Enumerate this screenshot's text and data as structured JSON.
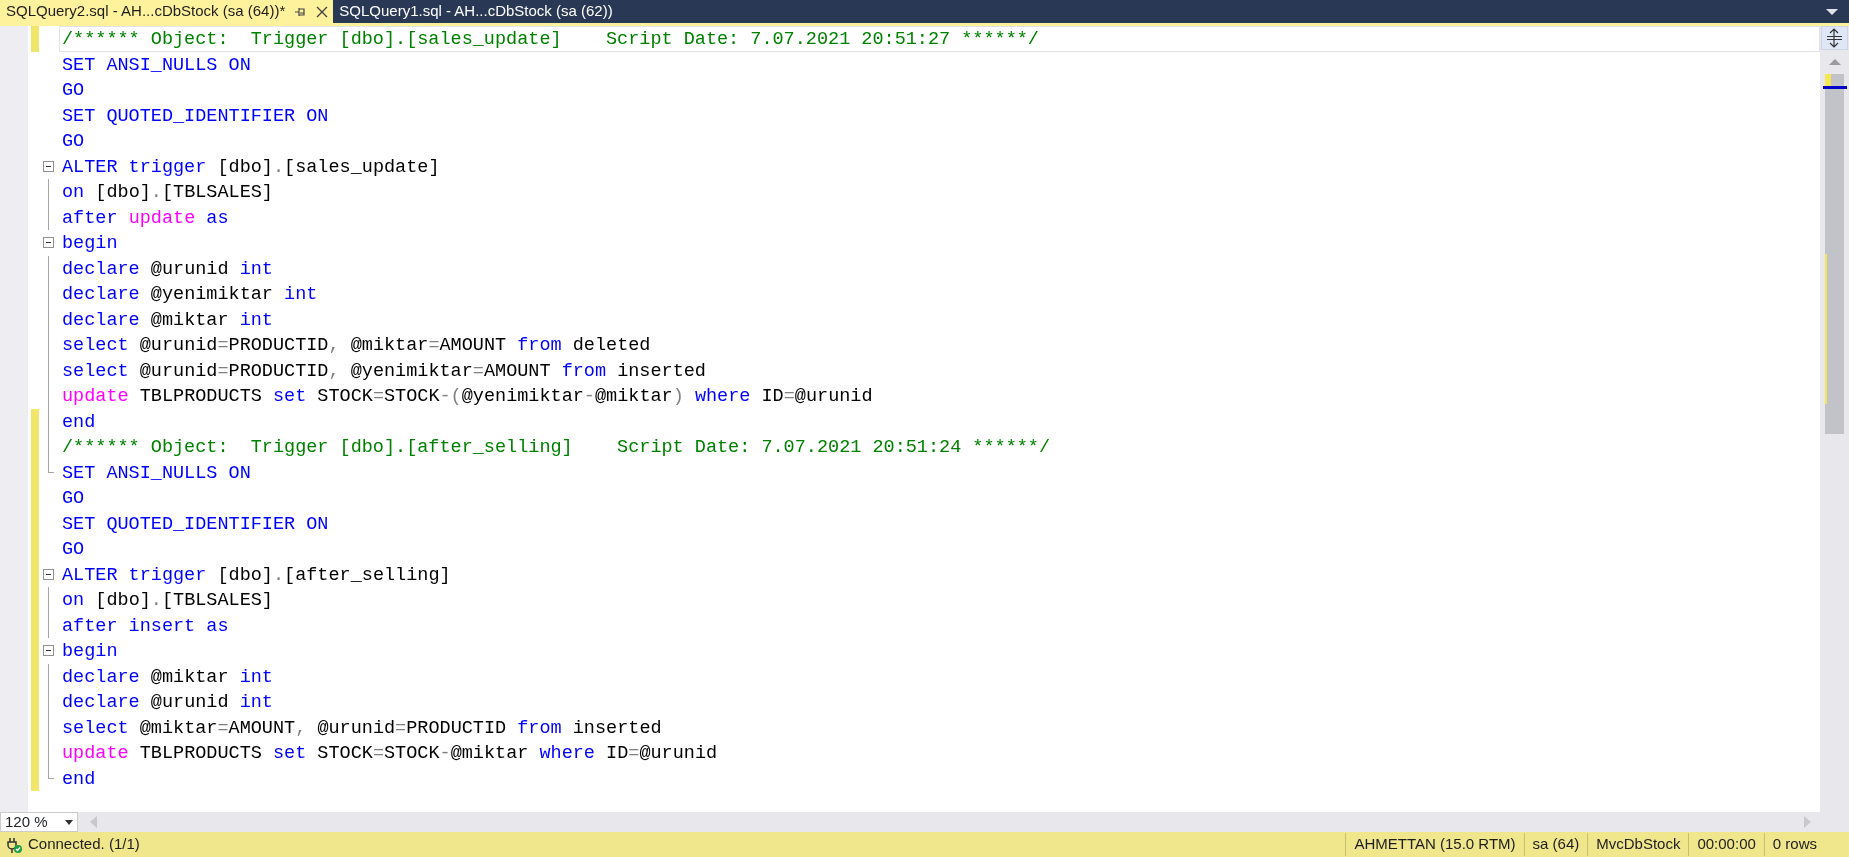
{
  "tabs": [
    {
      "label": "SQLQuery2.sql - AH...cDbStock (sa (64))*",
      "selected": true
    },
    {
      "label": "SQLQuery1.sql - AH...cDbStock (sa (62))",
      "selected": false
    }
  ],
  "editor": {
    "lines": [
      {
        "changed": true,
        "current": true,
        "kind": "plain",
        "tokens": [
          {
            "kind": "comment",
            "text": "/****** Object:  Trigger [dbo].[sales_update]    Script Date: 7.07.2021 20:51:27 ******/"
          }
        ]
      },
      {
        "changed": false,
        "current": false,
        "kind": "plain",
        "tokens": [
          {
            "kind": "keyword",
            "text": "SET ANSI_NULLS ON"
          }
        ]
      },
      {
        "changed": false,
        "current": false,
        "kind": "plain",
        "tokens": [
          {
            "kind": "keyword",
            "text": "GO"
          }
        ]
      },
      {
        "changed": false,
        "current": false,
        "kind": "plain",
        "tokens": [
          {
            "kind": "keyword",
            "text": "SET QUOTED_IDENTIFIER ON"
          }
        ]
      },
      {
        "changed": false,
        "current": false,
        "kind": "plain",
        "tokens": [
          {
            "kind": "keyword",
            "text": "GO"
          }
        ]
      },
      {
        "changed": false,
        "current": false,
        "kind": "fold_start",
        "tokens": [
          {
            "kind": "keyword",
            "text": "ALTER trigger"
          },
          {
            "kind": "plain",
            "text": " [dbo]"
          },
          {
            "kind": "operator",
            "text": "."
          },
          {
            "kind": "plain",
            "text": "[sales_update]"
          }
        ]
      },
      {
        "changed": false,
        "current": false,
        "kind": "fold_inner",
        "tokens": [
          {
            "kind": "keyword",
            "text": "on"
          },
          {
            "kind": "plain",
            "text": " [dbo]"
          },
          {
            "kind": "operator",
            "text": "."
          },
          {
            "kind": "plain",
            "text": "[TBLSALES]"
          }
        ]
      },
      {
        "changed": false,
        "current": false,
        "kind": "fold_inner",
        "tokens": [
          {
            "kind": "keyword",
            "text": "after "
          },
          {
            "kind": "function",
            "text": "update"
          },
          {
            "kind": "keyword",
            "text": " as"
          }
        ]
      },
      {
        "changed": false,
        "current": false,
        "kind": "fold_start",
        "tokens": [
          {
            "kind": "keyword",
            "text": "begin"
          }
        ]
      },
      {
        "changed": false,
        "current": false,
        "kind": "fold_inner",
        "tokens": [
          {
            "kind": "keyword",
            "text": "declare "
          },
          {
            "kind": "plain",
            "text": "@urunid "
          },
          {
            "kind": "keyword",
            "text": "int"
          }
        ]
      },
      {
        "changed": false,
        "current": false,
        "kind": "fold_inner",
        "tokens": [
          {
            "kind": "keyword",
            "text": "declare "
          },
          {
            "kind": "plain",
            "text": "@yenimiktar "
          },
          {
            "kind": "keyword",
            "text": "int"
          }
        ]
      },
      {
        "changed": false,
        "current": false,
        "kind": "fold_inner",
        "tokens": [
          {
            "kind": "keyword",
            "text": "declare "
          },
          {
            "kind": "plain",
            "text": "@miktar "
          },
          {
            "kind": "keyword",
            "text": "int"
          }
        ]
      },
      {
        "changed": false,
        "current": false,
        "kind": "fold_inner",
        "tokens": [
          {
            "kind": "keyword",
            "text": "select "
          },
          {
            "kind": "plain",
            "text": "@urunid"
          },
          {
            "kind": "operator",
            "text": "="
          },
          {
            "kind": "plain",
            "text": "PRODUCTID"
          },
          {
            "kind": "operator",
            "text": ","
          },
          {
            "kind": "plain",
            "text": " @miktar"
          },
          {
            "kind": "operator",
            "text": "="
          },
          {
            "kind": "plain",
            "text": "AMOUNT "
          },
          {
            "kind": "keyword",
            "text": "from "
          },
          {
            "kind": "plain",
            "text": "deleted"
          }
        ]
      },
      {
        "changed": false,
        "current": false,
        "kind": "fold_inner",
        "tokens": [
          {
            "kind": "keyword",
            "text": "select "
          },
          {
            "kind": "plain",
            "text": "@urunid"
          },
          {
            "kind": "operator",
            "text": "="
          },
          {
            "kind": "plain",
            "text": "PRODUCTID"
          },
          {
            "kind": "operator",
            "text": ","
          },
          {
            "kind": "plain",
            "text": " @yenimiktar"
          },
          {
            "kind": "operator",
            "text": "="
          },
          {
            "kind": "plain",
            "text": "AMOUNT "
          },
          {
            "kind": "keyword",
            "text": "from "
          },
          {
            "kind": "plain",
            "text": "inserted"
          }
        ]
      },
      {
        "changed": false,
        "current": false,
        "kind": "fold_inner",
        "tokens": [
          {
            "kind": "function",
            "text": "update"
          },
          {
            "kind": "plain",
            "text": " TBLPRODUCTS "
          },
          {
            "kind": "keyword",
            "text": "set"
          },
          {
            "kind": "plain",
            "text": " STOCK"
          },
          {
            "kind": "operator",
            "text": "="
          },
          {
            "kind": "plain",
            "text": "STOCK"
          },
          {
            "kind": "operator",
            "text": "-("
          },
          {
            "kind": "plain",
            "text": "@yenimiktar"
          },
          {
            "kind": "operator",
            "text": "-"
          },
          {
            "kind": "plain",
            "text": "@miktar"
          },
          {
            "kind": "operator",
            "text": ")"
          },
          {
            "kind": "keyword",
            "text": " where "
          },
          {
            "kind": "plain",
            "text": "ID"
          },
          {
            "kind": "operator",
            "text": "="
          },
          {
            "kind": "plain",
            "text": "@urunid"
          }
        ]
      },
      {
        "changed": true,
        "current": false,
        "kind": "fold_inner",
        "tokens": [
          {
            "kind": "keyword",
            "text": "end"
          }
        ]
      },
      {
        "changed": true,
        "current": false,
        "kind": "fold_inner",
        "tokens": [
          {
            "kind": "comment",
            "text": "/****** Object:  Trigger [dbo].[after_selling]    Script Date: 7.07.2021 20:51:24 ******/"
          }
        ]
      },
      {
        "changed": true,
        "current": false,
        "kind": "fold_end",
        "tokens": [
          {
            "kind": "keyword",
            "text": "SET ANSI_NULLS ON"
          }
        ]
      },
      {
        "changed": true,
        "current": false,
        "kind": "plain",
        "tokens": [
          {
            "kind": "keyword",
            "text": "GO"
          }
        ]
      },
      {
        "changed": true,
        "current": false,
        "kind": "plain",
        "tokens": [
          {
            "kind": "keyword",
            "text": "SET QUOTED_IDENTIFIER ON"
          }
        ]
      },
      {
        "changed": true,
        "current": false,
        "kind": "plain",
        "tokens": [
          {
            "kind": "keyword",
            "text": "GO"
          }
        ]
      },
      {
        "changed": true,
        "current": false,
        "kind": "fold_start",
        "tokens": [
          {
            "kind": "keyword",
            "text": "ALTER trigger"
          },
          {
            "kind": "plain",
            "text": " [dbo]"
          },
          {
            "kind": "operator",
            "text": "."
          },
          {
            "kind": "plain",
            "text": "[after_selling]"
          }
        ]
      },
      {
        "changed": true,
        "current": false,
        "kind": "fold_inner",
        "tokens": [
          {
            "kind": "keyword",
            "text": "on"
          },
          {
            "kind": "plain",
            "text": " [dbo]"
          },
          {
            "kind": "operator",
            "text": "."
          },
          {
            "kind": "plain",
            "text": "[TBLSALES]"
          }
        ]
      },
      {
        "changed": true,
        "current": false,
        "kind": "fold_inner",
        "tokens": [
          {
            "kind": "keyword",
            "text": "after insert as"
          }
        ]
      },
      {
        "changed": true,
        "current": false,
        "kind": "fold_start",
        "tokens": [
          {
            "kind": "keyword",
            "text": "begin"
          }
        ]
      },
      {
        "changed": true,
        "current": false,
        "kind": "fold_inner",
        "tokens": [
          {
            "kind": "keyword",
            "text": "declare "
          },
          {
            "kind": "plain",
            "text": "@miktar "
          },
          {
            "kind": "keyword",
            "text": "int"
          }
        ]
      },
      {
        "changed": true,
        "current": false,
        "kind": "fold_inner",
        "tokens": [
          {
            "kind": "keyword",
            "text": "declare "
          },
          {
            "kind": "plain",
            "text": "@urunid "
          },
          {
            "kind": "keyword",
            "text": "int"
          }
        ]
      },
      {
        "changed": true,
        "current": false,
        "kind": "fold_inner",
        "tokens": [
          {
            "kind": "keyword",
            "text": "select "
          },
          {
            "kind": "plain",
            "text": "@miktar"
          },
          {
            "kind": "operator",
            "text": "="
          },
          {
            "kind": "plain",
            "text": "AMOUNT"
          },
          {
            "kind": "operator",
            "text": ","
          },
          {
            "kind": "plain",
            "text": " @urunid"
          },
          {
            "kind": "operator",
            "text": "="
          },
          {
            "kind": "plain",
            "text": "PRODUCTID "
          },
          {
            "kind": "keyword",
            "text": "from "
          },
          {
            "kind": "plain",
            "text": "inserted"
          }
        ]
      },
      {
        "changed": true,
        "current": false,
        "kind": "fold_inner",
        "tokens": [
          {
            "kind": "function",
            "text": "update"
          },
          {
            "kind": "plain",
            "text": " TBLPRODUCTS "
          },
          {
            "kind": "keyword",
            "text": "set"
          },
          {
            "kind": "plain",
            "text": " STOCK"
          },
          {
            "kind": "operator",
            "text": "="
          },
          {
            "kind": "plain",
            "text": "STOCK"
          },
          {
            "kind": "operator",
            "text": "-"
          },
          {
            "kind": "plain",
            "text": "@miktar"
          },
          {
            "kind": "keyword",
            "text": " where "
          },
          {
            "kind": "plain",
            "text": "ID"
          },
          {
            "kind": "operator",
            "text": "="
          },
          {
            "kind": "plain",
            "text": "@urunid"
          }
        ]
      },
      {
        "changed": true,
        "current": false,
        "kind": "fold_end",
        "tokens": [
          {
            "kind": "keyword",
            "text": "end"
          }
        ]
      }
    ]
  },
  "zoom": {
    "value": "120 %"
  },
  "status_bar": {
    "message": "Connected. (1/1)",
    "cells": [
      "AHMETTAN (15.0 RTM)",
      "sa (64)",
      "MvcDbStock",
      "00:00:00",
      "0 rows"
    ]
  }
}
